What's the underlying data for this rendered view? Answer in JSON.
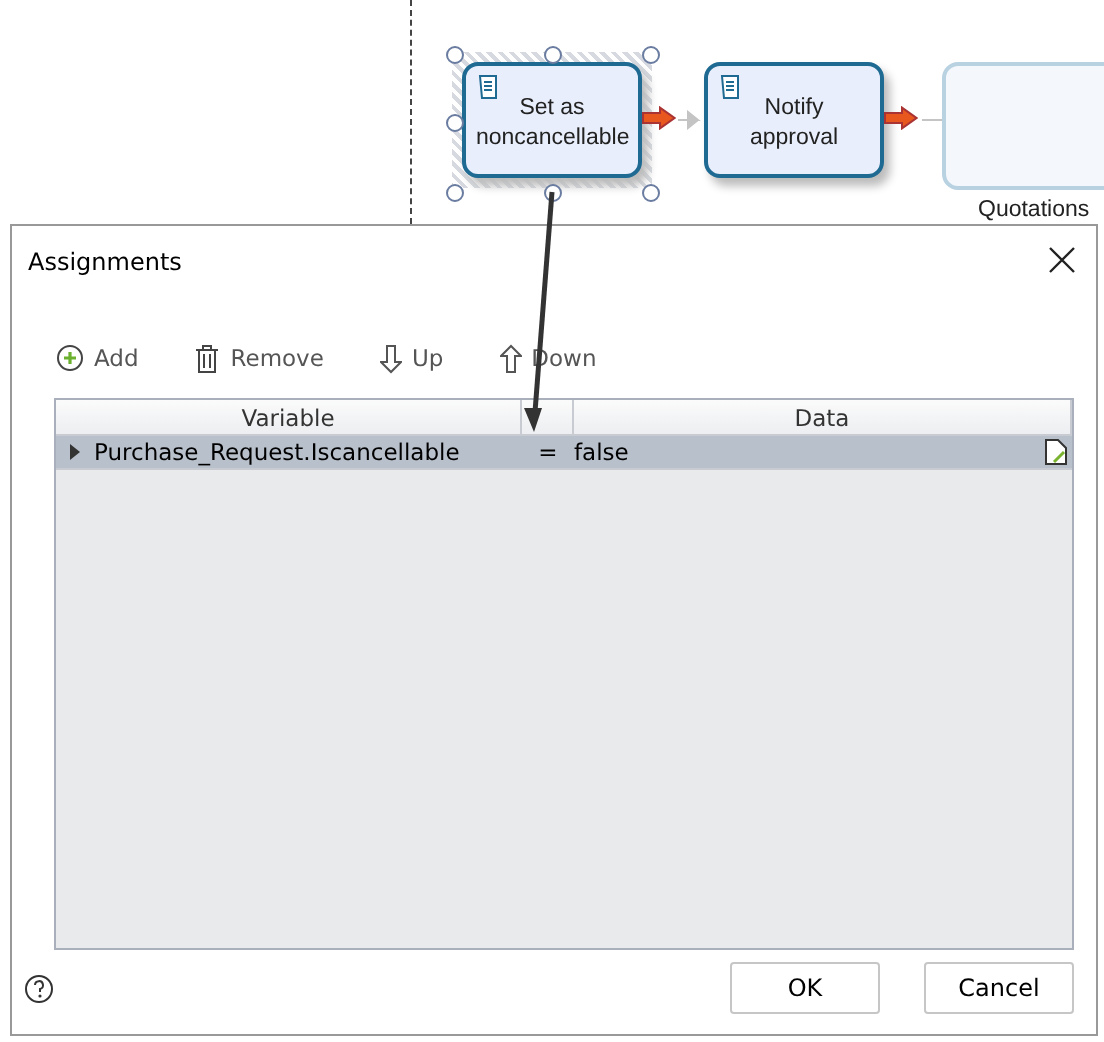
{
  "diagram": {
    "nodes": [
      {
        "label": "Set as noncancellable",
        "selected": true,
        "faded": false
      },
      {
        "label": "Notify approval",
        "selected": false,
        "faded": false
      },
      {
        "label": "Quotations",
        "selected": false,
        "faded": true
      }
    ]
  },
  "dialog": {
    "title": "Assignments",
    "toolbar": [
      {
        "kind": "add",
        "label": "Add"
      },
      {
        "kind": "remove",
        "label": "Remove"
      },
      {
        "kind": "up",
        "label": "Up"
      },
      {
        "kind": "down",
        "label": "Down"
      }
    ],
    "table": {
      "columns": [
        "Variable",
        "Data"
      ],
      "rows": [
        {
          "variable": "Purchase_Request.Iscancellable",
          "operator": "=",
          "data": "false",
          "selected": true
        }
      ]
    },
    "buttons": [
      "OK",
      "Cancel"
    ]
  }
}
